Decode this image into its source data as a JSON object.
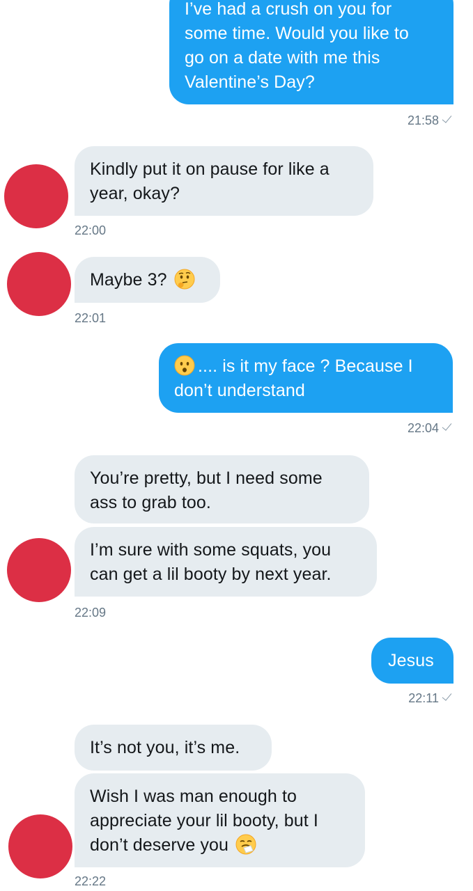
{
  "chat": {
    "messages": [
      {
        "side": "outgoing",
        "lines": [
          "I’ve had a crush on you for",
          "some time. Would you like to",
          "go on a date with me this",
          "Valentine’s Day?"
        ]
      },
      {
        "side": "outgoing",
        "timestamp": "21:58"
      },
      {
        "side": "incoming",
        "lines": [
          "Kindly put it on pause for like a",
          "year, okay?"
        ],
        "timestamp": "22:00"
      },
      {
        "side": "incoming",
        "text": "Maybe 3?",
        "emoji": "thinking-face-emoji",
        "timestamp": "22:01"
      },
      {
        "side": "outgoing",
        "emoji": "frowning-face-emoji",
        "line1": ".... is it my face ? Because I",
        "line2": "don’t understand",
        "timestamp": "22:04"
      },
      {
        "side": "incoming",
        "lines": [
          "You’re pretty, but I need some",
          "ass to grab too."
        ]
      },
      {
        "side": "incoming",
        "lines": [
          "I’m sure with some squats, you",
          "can get a lil booty by next year."
        ],
        "timestamp": "22:09"
      },
      {
        "side": "outgoing",
        "text": "Jesus",
        "timestamp": "22:11"
      },
      {
        "side": "incoming",
        "text": "It’s not you, it’s me."
      },
      {
        "side": "incoming",
        "lines": [
          "Wish I was man enough to",
          "appreciate your lil booty, but I"
        ],
        "line3": "don’t deserve you",
        "emoji": "sneezing-face-emoji",
        "timestamp": "22:22"
      }
    ]
  },
  "colors": {
    "outgoing_bubble": "#1da1f2",
    "incoming_bubble": "#e6ecf0",
    "avatar": "#dc2f45",
    "timestamp": "#657786"
  }
}
